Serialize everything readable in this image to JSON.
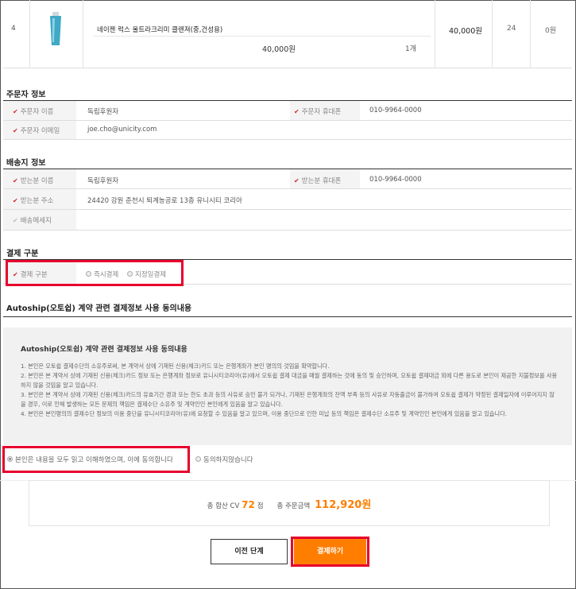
{
  "product": {
    "row_no": "4",
    "name": "네이젠 럭스 울트라크리미 클렌져(중,건성용)",
    "unit_price": "40,000원",
    "qty": "1개",
    "total_price": "40,000원",
    "cv": "24",
    "points": "0원"
  },
  "orderer": {
    "title": "주문자 정보",
    "name_label": "주문자 이름",
    "name_value": "독립후원자",
    "phone_label": "주문자 휴대폰",
    "phone_value": "010-9964-0000",
    "email_label": "주문자 이메일",
    "email_value": "joe.cho@unicity.com"
  },
  "shipping": {
    "title": "배송지 정보",
    "recipient_label": "받는분 이름",
    "recipient_value": "독립후원자",
    "phone_label": "받는분 휴대폰",
    "phone_value": "010-9964-0000",
    "address_label": "받는분 주소",
    "address_value": "24420 강원 춘천시 퇴계농공로 13층 유니시티 코리아",
    "message_label": "배송메세지",
    "message_value": ""
  },
  "payment": {
    "title": "결제 구분",
    "label": "결제 구분",
    "option_immediate": "즉시결제",
    "option_scheduled": "지정일결제"
  },
  "autoship": {
    "section_title": "Autoship(오토쉽) 계약 관련 결제정보 사용 동의내용",
    "box_title": "Autoship(오토쉽) 계약 관련 결제정보 사용 동의내용",
    "lines": [
      "1. 본인은 오토쉽 결제수단의 소유주로써, 본 계약서 상에 기재된 신용(체크)카드 또는 은행계좌가 본인 명의의 것임을 확약합니다.",
      "2. 본인은 본 계약서 상에 기재된 신용(체크)카드 정보 또는 은행계좌 정보로 유니시티코리아(유)에서 오토쉽 결제 대금을 매월 결제하는 것에 동의 및 승인하며, 오토쉽 결제대금 외에 다른 용도로 본인이 제공한 지불정보를 사용하지 않을 것임을 알고 있습니다.",
      "3. 본인은 본 계약서 상에 기재된 신용(체크)카드의 유효기간 경과 또는 한도 초과 등의 사유로 승인 불가 되거나, 기재된 은행계좌의 잔액 부족 등의 사유로 자동출금이 불가하여 오토쉽 결제가 약정된 결제일자에 이루어지지 않을 경우, 이로 인해 발생하는 모든 문제의 책임은 결제수단 소유주 및 계약인인 본인에게 있음을 알고 있습니다.",
      "4. 본인은 본인명의의 결제수단 정보의 이용 중단을 유니시티코리아(유)에 요청할 수 있음을 알고 있으며, 이용 중단으로 인한 미납 등의 책임은 결제수단 소유주 및 계약인인 본인에게 있음을 알고 있습니다."
    ],
    "agree_label": "본인은 내용을 모두 읽고 이해하였으며, 이에 동의합니다",
    "disagree_label": "동의하지않습니다"
  },
  "totals": {
    "cv_label": "총 합산 CV",
    "cv_value": "72",
    "cv_unit": "점",
    "amount_label": "총 주문금액",
    "amount_value": "112,920원"
  },
  "buttons": {
    "prev": "이전 단계",
    "pay": "결제하기"
  },
  "colors": {
    "accent": "#ff7e00",
    "highlight": "#e6002d",
    "required": "#d62828"
  }
}
